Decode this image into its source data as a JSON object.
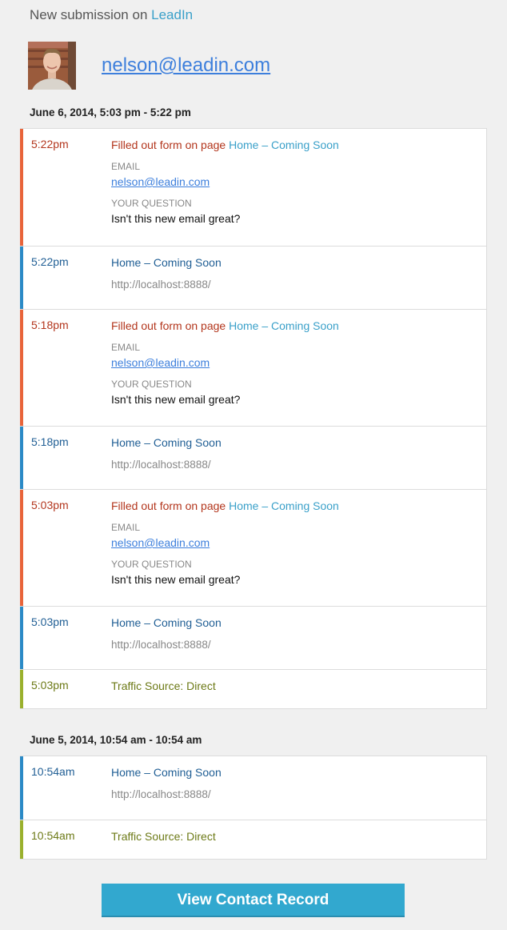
{
  "header": {
    "prefix": "New submission on ",
    "brand": "LeadIn"
  },
  "contact": {
    "email": "nelson@leadin.com",
    "avatar_icon": "person-photo-icon"
  },
  "colors": {
    "form": "#e8643a",
    "page": "#2b8ac6",
    "traffic": "#9ab02d"
  },
  "sessions": [
    {
      "title": "June 6, 2014, 5:03 pm - 5:22 pm",
      "events": [
        {
          "type": "form",
          "time": "5:22pm",
          "prefix": "Filled out form on page ",
          "page": "Home – Coming Soon",
          "fields": [
            {
              "label": "EMAIL",
              "value": "nelson@leadin.com",
              "link": true
            },
            {
              "label": "YOUR QUESTION",
              "value": "Isn't this new email great?",
              "link": false
            }
          ]
        },
        {
          "type": "page",
          "time": "5:22pm",
          "page": "Home – Coming Soon",
          "url": "http://localhost:8888/"
        },
        {
          "type": "form",
          "time": "5:18pm",
          "prefix": "Filled out form on page ",
          "page": "Home – Coming Soon",
          "fields": [
            {
              "label": "EMAIL",
              "value": "nelson@leadin.com",
              "link": true
            },
            {
              "label": "YOUR QUESTION",
              "value": "Isn't this new email great?",
              "link": false
            }
          ]
        },
        {
          "type": "page",
          "time": "5:18pm",
          "page": "Home – Coming Soon",
          "url": "http://localhost:8888/"
        },
        {
          "type": "form",
          "time": "5:03pm",
          "prefix": "Filled out form on page ",
          "page": "Home – Coming Soon",
          "fields": [
            {
              "label": "EMAIL",
              "value": "nelson@leadin.com",
              "link": true
            },
            {
              "label": "YOUR QUESTION",
              "value": "Isn't this new email great?",
              "link": false
            }
          ]
        },
        {
          "type": "page",
          "time": "5:03pm",
          "page": "Home – Coming Soon",
          "url": "http://localhost:8888/"
        },
        {
          "type": "traffic",
          "time": "5:03pm",
          "text": "Traffic Source: Direct"
        }
      ]
    },
    {
      "title": "June 5, 2014, 10:54 am - 10:54 am",
      "events": [
        {
          "type": "page",
          "time": "10:54am",
          "page": "Home – Coming Soon",
          "url": "http://localhost:8888/"
        },
        {
          "type": "traffic",
          "time": "10:54am",
          "text": "Traffic Source: Direct"
        }
      ]
    }
  ],
  "cta": {
    "label": "View Contact Record"
  }
}
